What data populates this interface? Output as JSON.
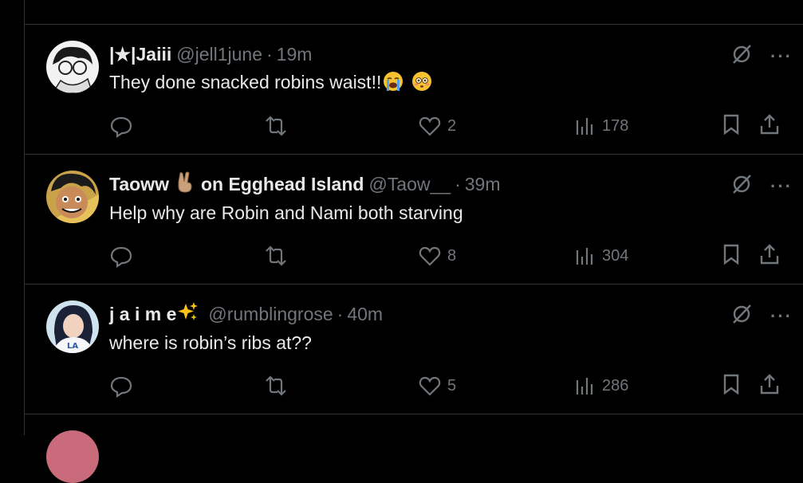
{
  "tweets": [
    {
      "name": "|★|Jaiii",
      "name_extra": "",
      "handle": "@jell1june",
      "separator": "·",
      "time": "19m",
      "text": "They done snacked robins waist!!",
      "text_emoji": [
        "loudly-crying-face",
        "flushed-face"
      ],
      "replies": "",
      "reposts": "",
      "likes": "2",
      "views": "178"
    },
    {
      "name": "Taoww",
      "name_emoji": "victory-hand",
      "name_extra": "on Egghead Island",
      "handle": "@Taow__",
      "separator": "·",
      "time": "39m",
      "text": "Help why are Robin and Nami both starving",
      "replies": "",
      "reposts": "",
      "likes": "8",
      "views": "304"
    },
    {
      "name": "j a i m e",
      "name_emoji": "sparkles",
      "name_extra": "",
      "handle": "@rumblingrose",
      "separator": "·",
      "time": "40m",
      "text": "where is robin’s ribs at??",
      "replies": "",
      "reposts": "",
      "likes": "5",
      "views": "286"
    }
  ],
  "colors": {
    "background": "#000000",
    "text": "#e7e9ea",
    "muted": "#71767b",
    "border": "#2f3336"
  }
}
